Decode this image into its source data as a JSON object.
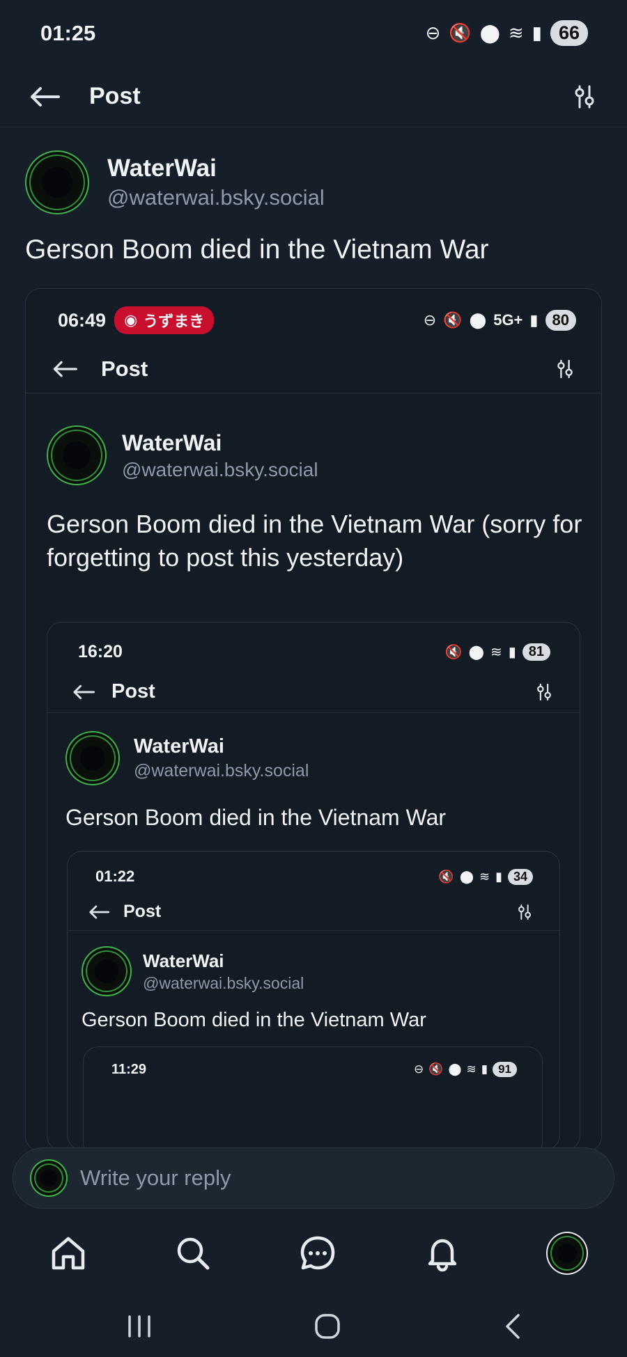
{
  "status_bar": {
    "time": "01:25",
    "battery": "66"
  },
  "header": {
    "title": "Post"
  },
  "post": {
    "author_name": "WaterWai",
    "author_handle": "@waterwai.bsky.social",
    "text": "Gerson Boom died in the Vietnam War"
  },
  "embed1": {
    "time": "06:49",
    "media_badge": "うずまき",
    "network": "5G+",
    "battery": "80",
    "title": "Post",
    "author_name": "WaterWai",
    "author_handle": "@waterwai.bsky.social",
    "text": "Gerson Boom died in the Vietnam War (sorry for forgetting to post this yesterday)"
  },
  "embed2": {
    "time": "16:20",
    "battery": "81",
    "title": "Post",
    "author_name": "WaterWai",
    "author_handle": "@waterwai.bsky.social",
    "text": "Gerson Boom died in the Vietnam War"
  },
  "embed3": {
    "time": "01:22",
    "battery": "34",
    "title": "Post",
    "author_name": "WaterWai",
    "author_handle": "@waterwai.bsky.social",
    "text": "Gerson Boom died in the Vietnam War"
  },
  "embed4": {
    "time": "11:29",
    "battery": "91"
  },
  "reply": {
    "placeholder": "Write your reply"
  },
  "nav": [
    "home-icon",
    "search-icon",
    "chat-icon",
    "bell-icon",
    "profile-avatar"
  ],
  "colors": {
    "background": "#161e29",
    "accent_green": "#3fb34a",
    "badge_red": "#c8102e"
  }
}
